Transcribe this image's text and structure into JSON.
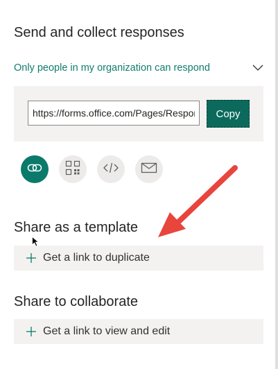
{
  "send_section": {
    "title": "Send and collect responses",
    "permission_dropdown": {
      "selected": "Only people in my organization can respond",
      "icon": "chevron-down-icon"
    },
    "link_box": {
      "url_value": "https://forms.office.com/Pages/ResponsePage.aspx",
      "copy_label": "Copy"
    },
    "share_methods": [
      {
        "icon": "link-icon",
        "active": true
      },
      {
        "icon": "qr-code-icon",
        "active": false
      },
      {
        "icon": "embed-code-icon",
        "active": false
      },
      {
        "icon": "email-icon",
        "active": false
      }
    ]
  },
  "template_section": {
    "title": "Share as a template",
    "action_label": "Get a link to duplicate"
  },
  "collaborate_section": {
    "title": "Share to collaborate",
    "action_label": "Get a link to view and edit"
  },
  "colors": {
    "accent": "#0b7a6b",
    "link_text": "#107c6f",
    "panel_bg": "#f3f2f1",
    "annotation_arrow": "#e8453c"
  }
}
